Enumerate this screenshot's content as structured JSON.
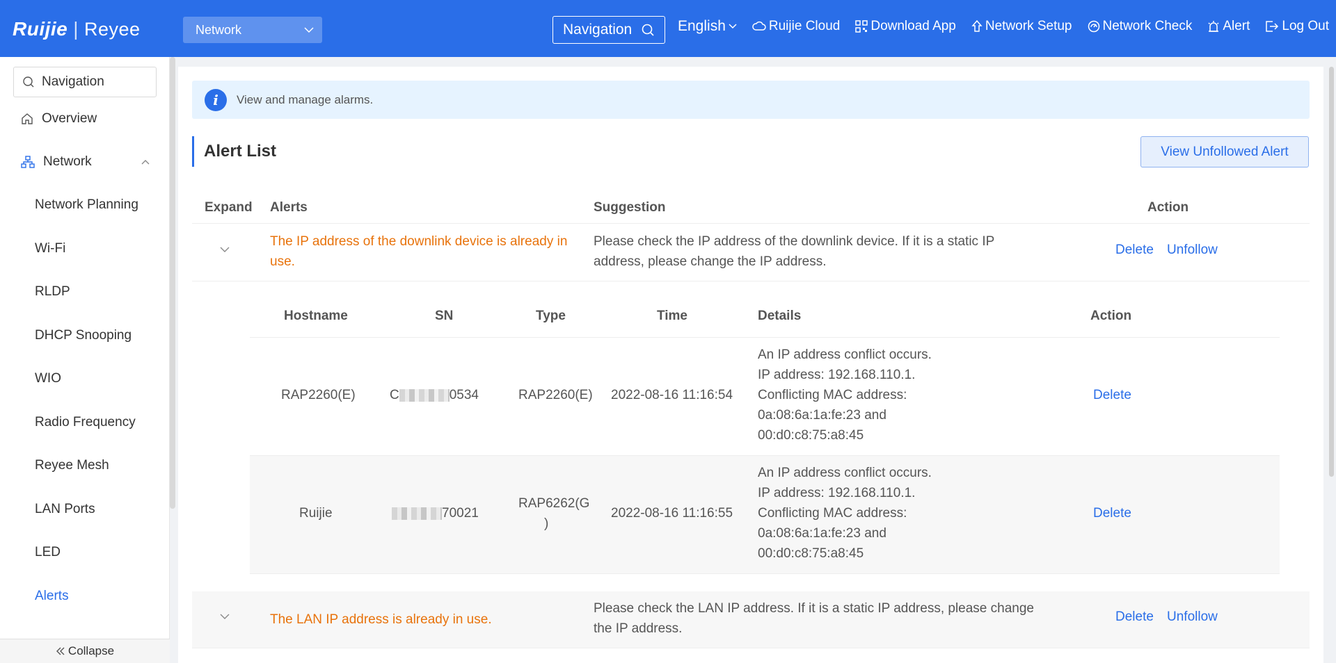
{
  "header": {
    "logo_ruijie": "Ruijie",
    "logo_separator": "|",
    "logo_reyee": "Reyee",
    "network_select": "Network",
    "navigation_search": "Navigation",
    "language": "English",
    "menu": [
      {
        "label": "Ruijie Cloud",
        "icon": "cloud-icon"
      },
      {
        "label": "Download App",
        "icon": "qr-code-icon"
      },
      {
        "label": "Network Setup",
        "icon": "setup-icon"
      },
      {
        "label": "Network Check",
        "icon": "network-check-icon"
      },
      {
        "label": "Alert",
        "icon": "alarm-icon"
      },
      {
        "label": "Log Out",
        "icon": "logout-icon"
      }
    ]
  },
  "sidebar": {
    "search_placeholder": "Navigation",
    "overview": "Overview",
    "network": "Network",
    "items": [
      "Network Planning",
      "Wi-Fi",
      "RLDP",
      "DHCP Snooping",
      "WIO",
      "Radio Frequency",
      "Reyee Mesh",
      "LAN Ports",
      "LED",
      "Alerts"
    ],
    "active_item": "Alerts",
    "collapse": "Collapse"
  },
  "main": {
    "info_text": "View and manage alarms.",
    "section_title": "Alert List",
    "view_unfollowed_button": "View Unfollowed Alert",
    "table": {
      "headers": {
        "expand": "Expand",
        "alerts": "Alerts",
        "suggestion": "Suggestion",
        "action": "Action"
      },
      "rows": [
        {
          "alert_line1": "The IP address of the downlink device is already in",
          "alert_line2": "use.",
          "suggestion_line1": "Please check the IP address of the downlink device. If it is a static IP",
          "suggestion_line2": "address, please change the IP address.",
          "delete": "Delete",
          "unfollow": "Unfollow"
        },
        {
          "alert_line1": "The LAN IP address is already in use.",
          "suggestion_line1": "Please check the LAN IP address. If it is a static IP address, please change",
          "suggestion_line2": "the IP address.",
          "delete": "Delete",
          "unfollow": "Unfollow"
        }
      ]
    },
    "sub_table": {
      "headers": {
        "hostname": "Hostname",
        "sn": "SN",
        "type": "Type",
        "time": "Time",
        "details": "Details",
        "action": "Action"
      },
      "rows": [
        {
          "hostname": "RAP2260(E)",
          "sn_prefix": "C",
          "sn_suffix": "0534",
          "type_line1": "RAP2260(E)",
          "type_line2": "",
          "time": "2022-08-16 11:16:54",
          "details": [
            "An IP address conflict occurs.",
            "IP address: 192.168.110.1.",
            "Conflicting MAC address:",
            "0a:08:6a:1a:fe:23 and",
            "00:d0:c8:75:a8:45"
          ],
          "delete": "Delete"
        },
        {
          "hostname": "Ruijie",
          "sn_prefix": "",
          "sn_suffix": "70021",
          "type_line1": "RAP6262(G",
          "type_line2": ")",
          "time": "2022-08-16 11:16:55",
          "details": [
            "An IP address conflict occurs.",
            "IP address: 192.168.110.1.",
            "Conflicting MAC address:",
            "0a:08:6a:1a:fe:23 and",
            "00:d0:c8:75:a8:45"
          ],
          "delete": "Delete"
        }
      ]
    }
  },
  "colors": {
    "brand_blue": "#2a6ee8",
    "alert_orange": "#e8730c",
    "info_bg": "#e6f3ff"
  }
}
